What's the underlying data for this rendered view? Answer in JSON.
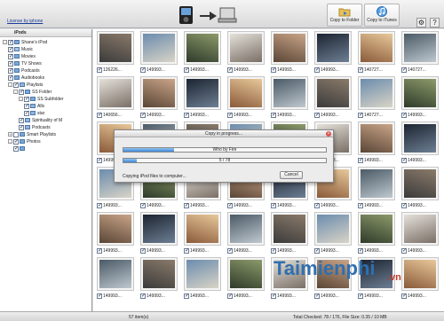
{
  "toolbar": {
    "license_link": "License by iphone",
    "copy_to_folder_label": "Copy to Folder",
    "copy_to_itunes_label": "Copy to iTunes"
  },
  "sidebar": {
    "header": "iPods",
    "tree": [
      {
        "label": "Shane's iPod",
        "level": 0,
        "expander": "-",
        "icon": "ipod-icon",
        "checked": true
      },
      {
        "label": "Music",
        "level": 1,
        "icon": "music-icon",
        "checked": true
      },
      {
        "label": "Movies",
        "level": 1,
        "icon": "movie-icon",
        "checked": true
      },
      {
        "label": "TV Shows",
        "level": 1,
        "icon": "tv-icon",
        "checked": true
      },
      {
        "label": "Podcasts",
        "level": 1,
        "icon": "podcast-icon",
        "checked": true
      },
      {
        "label": "Audiobooks",
        "level": 1,
        "icon": "audiobook-icon",
        "checked": true
      },
      {
        "label": "Playlists",
        "level": 1,
        "expander": "-",
        "icon": "playlist-icon",
        "checked": true
      },
      {
        "label": "SS Folder",
        "level": 2,
        "expander": "-",
        "icon": "folder-icon",
        "checked": true
      },
      {
        "label": "SS Subfolder",
        "level": 3,
        "expander": "-",
        "icon": "folder-icon",
        "checked": true
      },
      {
        "label": "Alls",
        "level": 4,
        "icon": "playlist-icon",
        "checked": true
      },
      {
        "label": "star",
        "level": 4,
        "icon": "playlist-icon",
        "checked": true
      },
      {
        "label": "Spirituality of M",
        "level": 3,
        "icon": "playlist-icon",
        "checked": true
      },
      {
        "label": "Podcasts",
        "level": 3,
        "icon": "playlist-icon",
        "checked": true
      },
      {
        "label": "Smart Playlists",
        "level": 1,
        "expander": "+",
        "icon": "smart-playlist-icon",
        "checked": false
      },
      {
        "label": "Photos",
        "level": 1,
        "expander": "-",
        "icon": "photo-icon",
        "checked": true
      },
      {
        "label": "",
        "level": 2,
        "icon": "photo-album-icon",
        "checked": true
      }
    ]
  },
  "grid": {
    "rows": [
      [
        "126226...",
        "149993...",
        "149993...",
        "149993...",
        "149993...",
        "149993...",
        "140727...",
        "140727..."
      ],
      [
        "140656...",
        "149993...",
        "149993...",
        "149993...",
        "149993...",
        "149993...",
        "140727...",
        "149993..."
      ],
      [
        "149993...",
        "149993...",
        "149993...",
        "149993...",
        "149993...",
        "149993...",
        "149993...",
        "149993..."
      ],
      [
        "149993...",
        "149993...",
        "149993...",
        "149993...",
        "149993...",
        "149993...",
        "149993...",
        "149993..."
      ],
      [
        "149993...",
        "149993...",
        "149993...",
        "149993...",
        "149993...",
        "149993...",
        "149993...",
        "149993..."
      ],
      [
        "149993...",
        "149993...",
        "149993...",
        "149993...",
        "149993...",
        "149993...",
        "149993...",
        "149993..."
      ]
    ]
  },
  "statusbar": {
    "item_count": "57 item(s)",
    "totals": "Total Checked: 78 / 176, File Size: 0.35 / 10 MB"
  },
  "dialog": {
    "title": "Copy in progress...",
    "track_label": "Who by Fire",
    "track_progress": 0.25,
    "count_label": "5 / 78",
    "count_progress": 0.064,
    "status_text": "Copying iPod files to computer...",
    "cancel_label": "Cancel"
  },
  "watermarks": {
    "brand": "Taimienphi",
    "brand_suffix": ".vn"
  },
  "colors": {
    "link": "#1a3d9a",
    "progress_fill": "#3f86d6",
    "watermark_blue": "#2f6fb0",
    "watermark_red": "#c0392b"
  }
}
